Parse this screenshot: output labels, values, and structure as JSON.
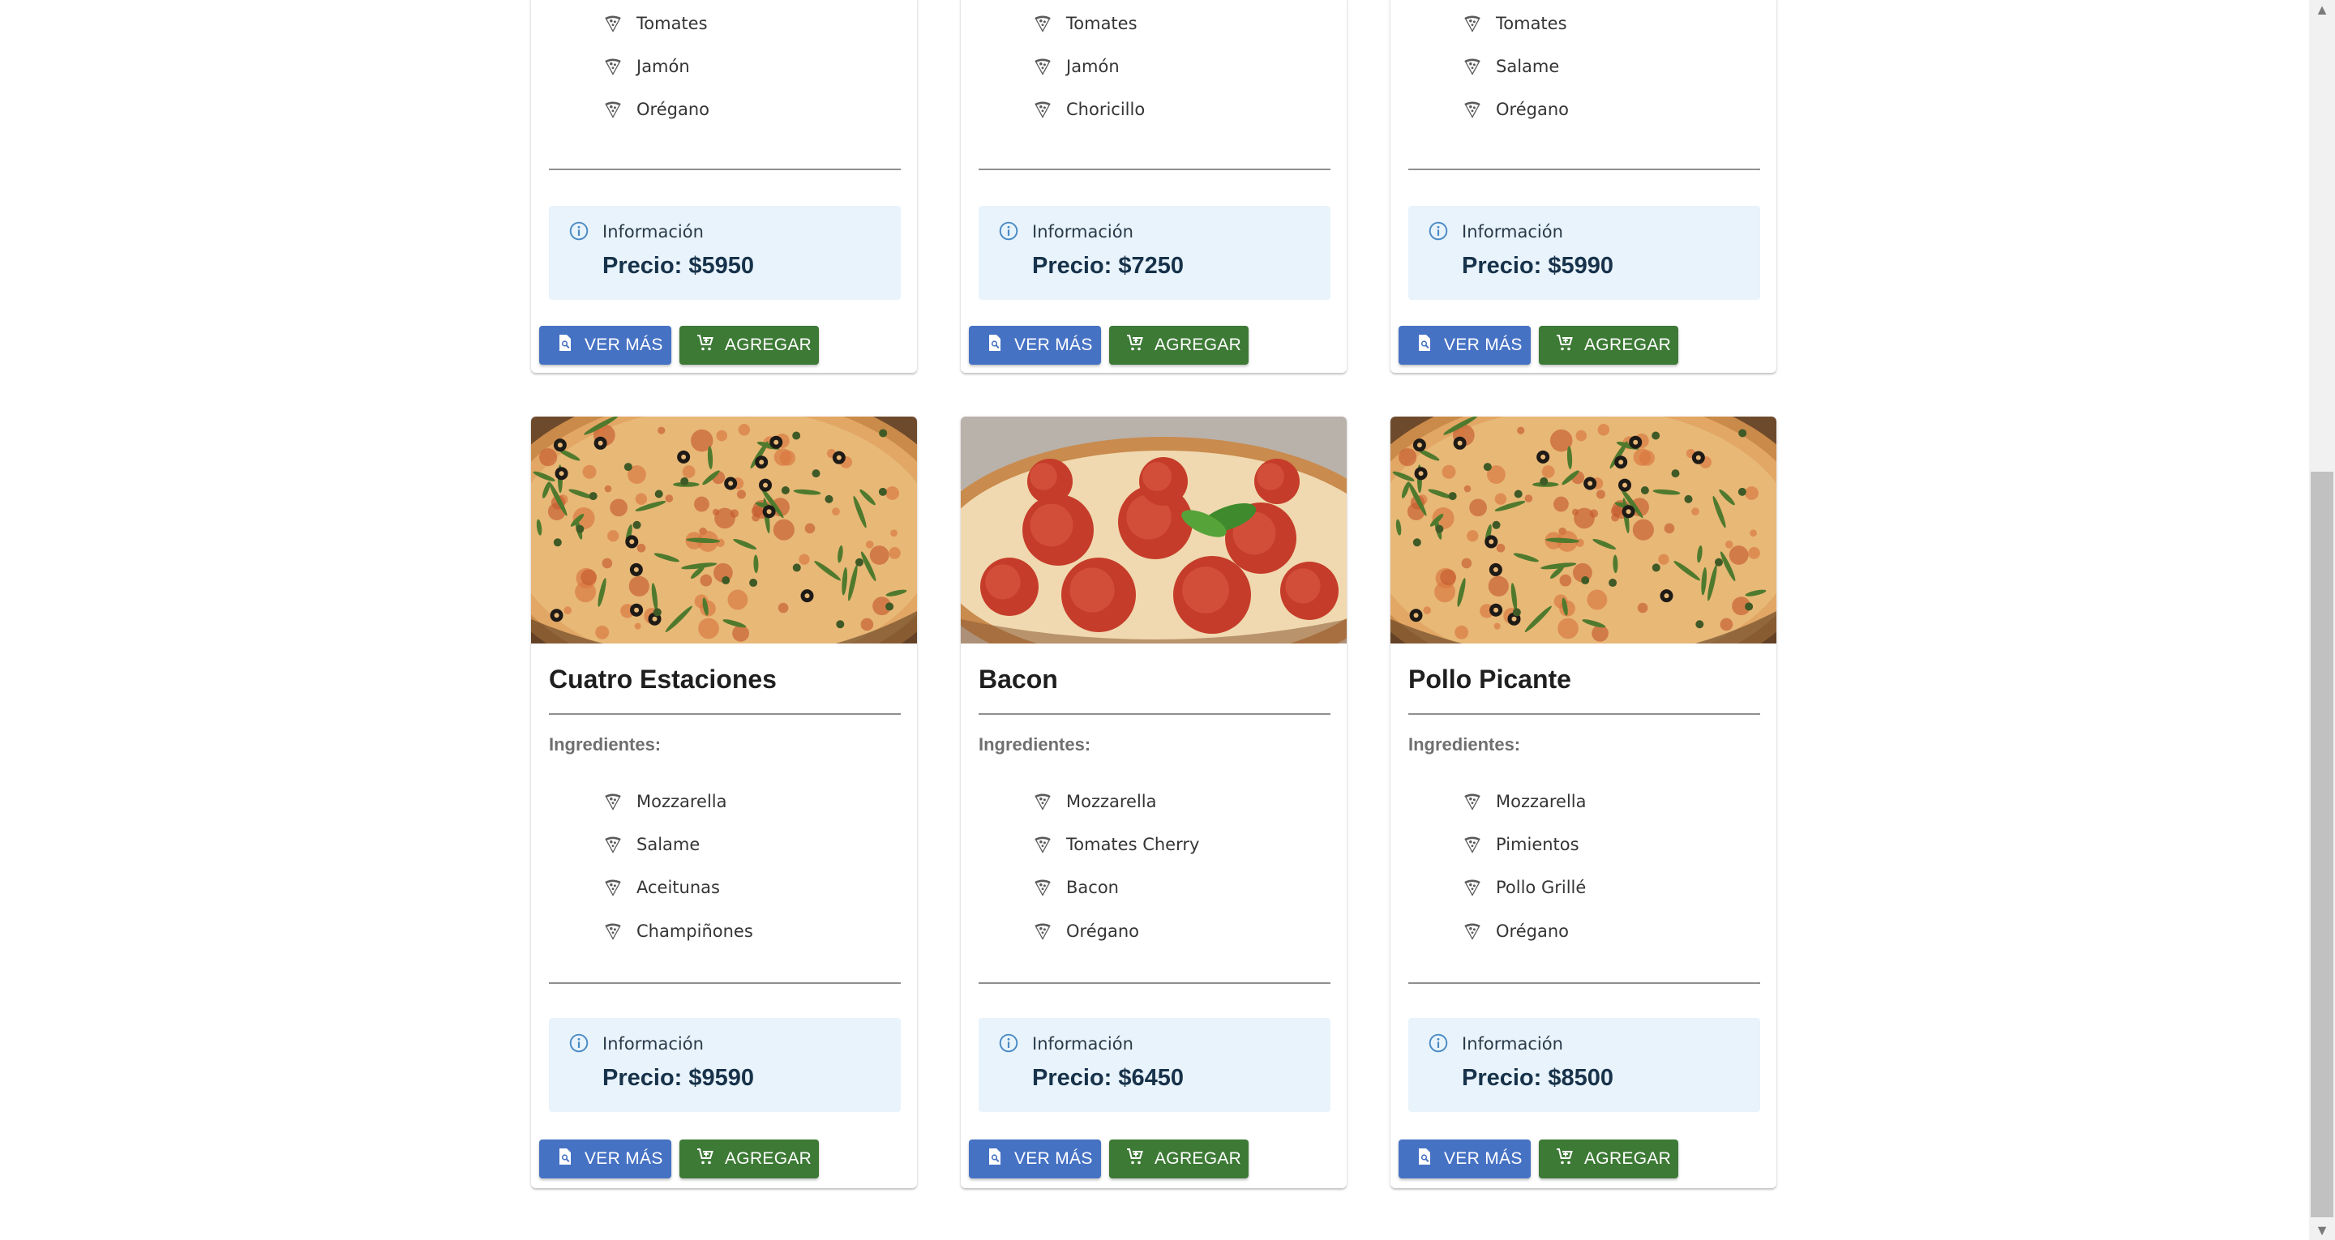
{
  "info_label": "Información",
  "ingredients_heading": "Ingredientes:",
  "buttons": {
    "more_label": "VER MÁS",
    "add_label": "AGREGAR"
  },
  "colors": {
    "more_button": "#4672c4",
    "add_button": "#3d7a35",
    "info_box": "#e8f3fb"
  },
  "icons": {
    "ingredient": "pizza-slice-icon",
    "info": "info-icon",
    "more": "search-document-icon",
    "add": "add-cart-icon"
  },
  "top_row": [
    {
      "price": "Precio: $5950",
      "ingredients": [
        "Tomates",
        "Jamón",
        "Orégano"
      ]
    },
    {
      "price": "Precio: $7250",
      "ingredients": [
        "Tomates",
        "Jamón",
        "Choricillo"
      ]
    },
    {
      "price": "Precio: $5990",
      "ingredients": [
        "Tomates",
        "Salame",
        "Orégano"
      ]
    }
  ],
  "bottom_row": [
    {
      "name": "Cuatro Estaciones",
      "photo": "pizza-olives-arugula",
      "price": "Precio: $9590",
      "ingredients": [
        "Mozzarella",
        "Salame",
        "Aceitunas",
        "Champiñones"
      ]
    },
    {
      "name": "Bacon",
      "photo": "pizza-pepperoni-basil",
      "price": "Precio: $6450",
      "ingredients": [
        "Mozzarella",
        "Tomates Cherry",
        "Bacon",
        "Orégano"
      ]
    },
    {
      "name": "Pollo Picante",
      "photo": "pizza-olives-arugula",
      "price": "Precio: $8500",
      "ingredients": [
        "Mozzarella",
        "Pimientos",
        "Pollo Grillé",
        "Orégano"
      ]
    }
  ]
}
